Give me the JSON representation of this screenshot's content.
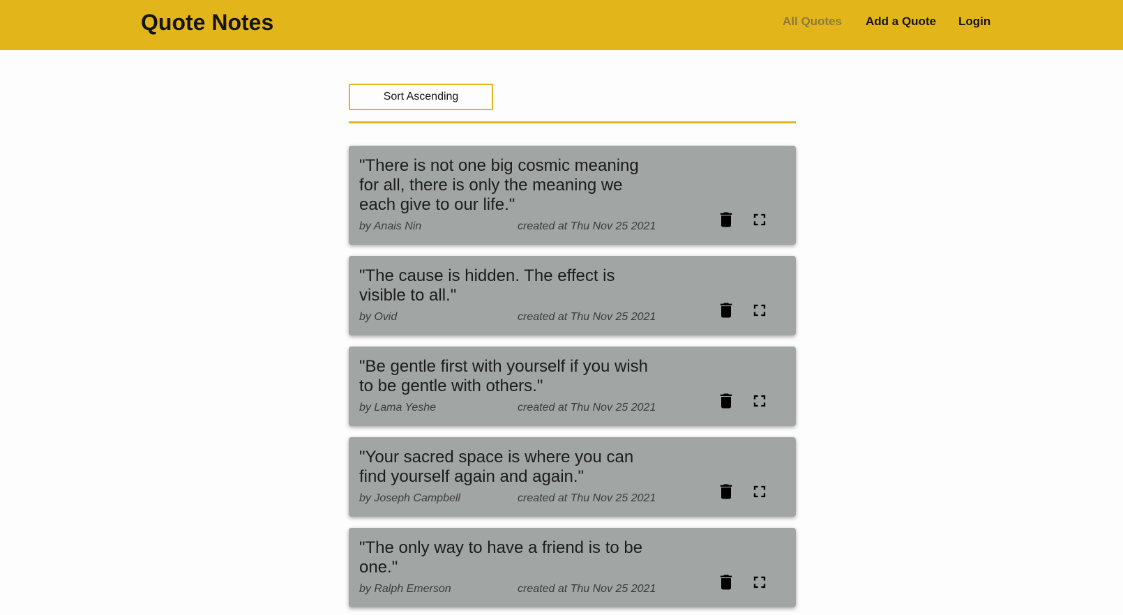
{
  "header": {
    "logo": "Quote Notes",
    "nav": {
      "all_quotes": "All Quotes",
      "add_quote": "Add a Quote",
      "login": "Login"
    },
    "active_nav": "All Quotes"
  },
  "sort": {
    "label": "Sort Ascending"
  },
  "colors": {
    "header_bg": "#e2b51a",
    "card_bg": "#a1a5a4",
    "active_nav": "#8c7a3e"
  },
  "quotes": [
    {
      "text": "\"There is not one big cosmic meaning for all, there is only the meaning we each give to our life.\"",
      "author": "by Anais Nin",
      "created": "created at Thu Nov 25 2021"
    },
    {
      "text": "\"The cause is hidden. The effect is visible to all.\"",
      "author": "by Ovid",
      "created": "created at Thu Nov 25 2021"
    },
    {
      "text": "\"Be gentle first with yourself if you wish to be gentle with others.\"",
      "author": "by Lama Yeshe",
      "created": "created at Thu Nov 25 2021"
    },
    {
      "text": "\"Your sacred space is where you can find yourself again and again.\"",
      "author": "by Joseph Campbell",
      "created": "created at Thu Nov 25 2021"
    },
    {
      "text": "\"The only way to have a friend is to be one.\"",
      "author": "by Ralph Emerson",
      "created": "created at Thu Nov 25 2021"
    }
  ],
  "icons": {
    "delete": "trash-icon",
    "expand": "expand-icon"
  }
}
